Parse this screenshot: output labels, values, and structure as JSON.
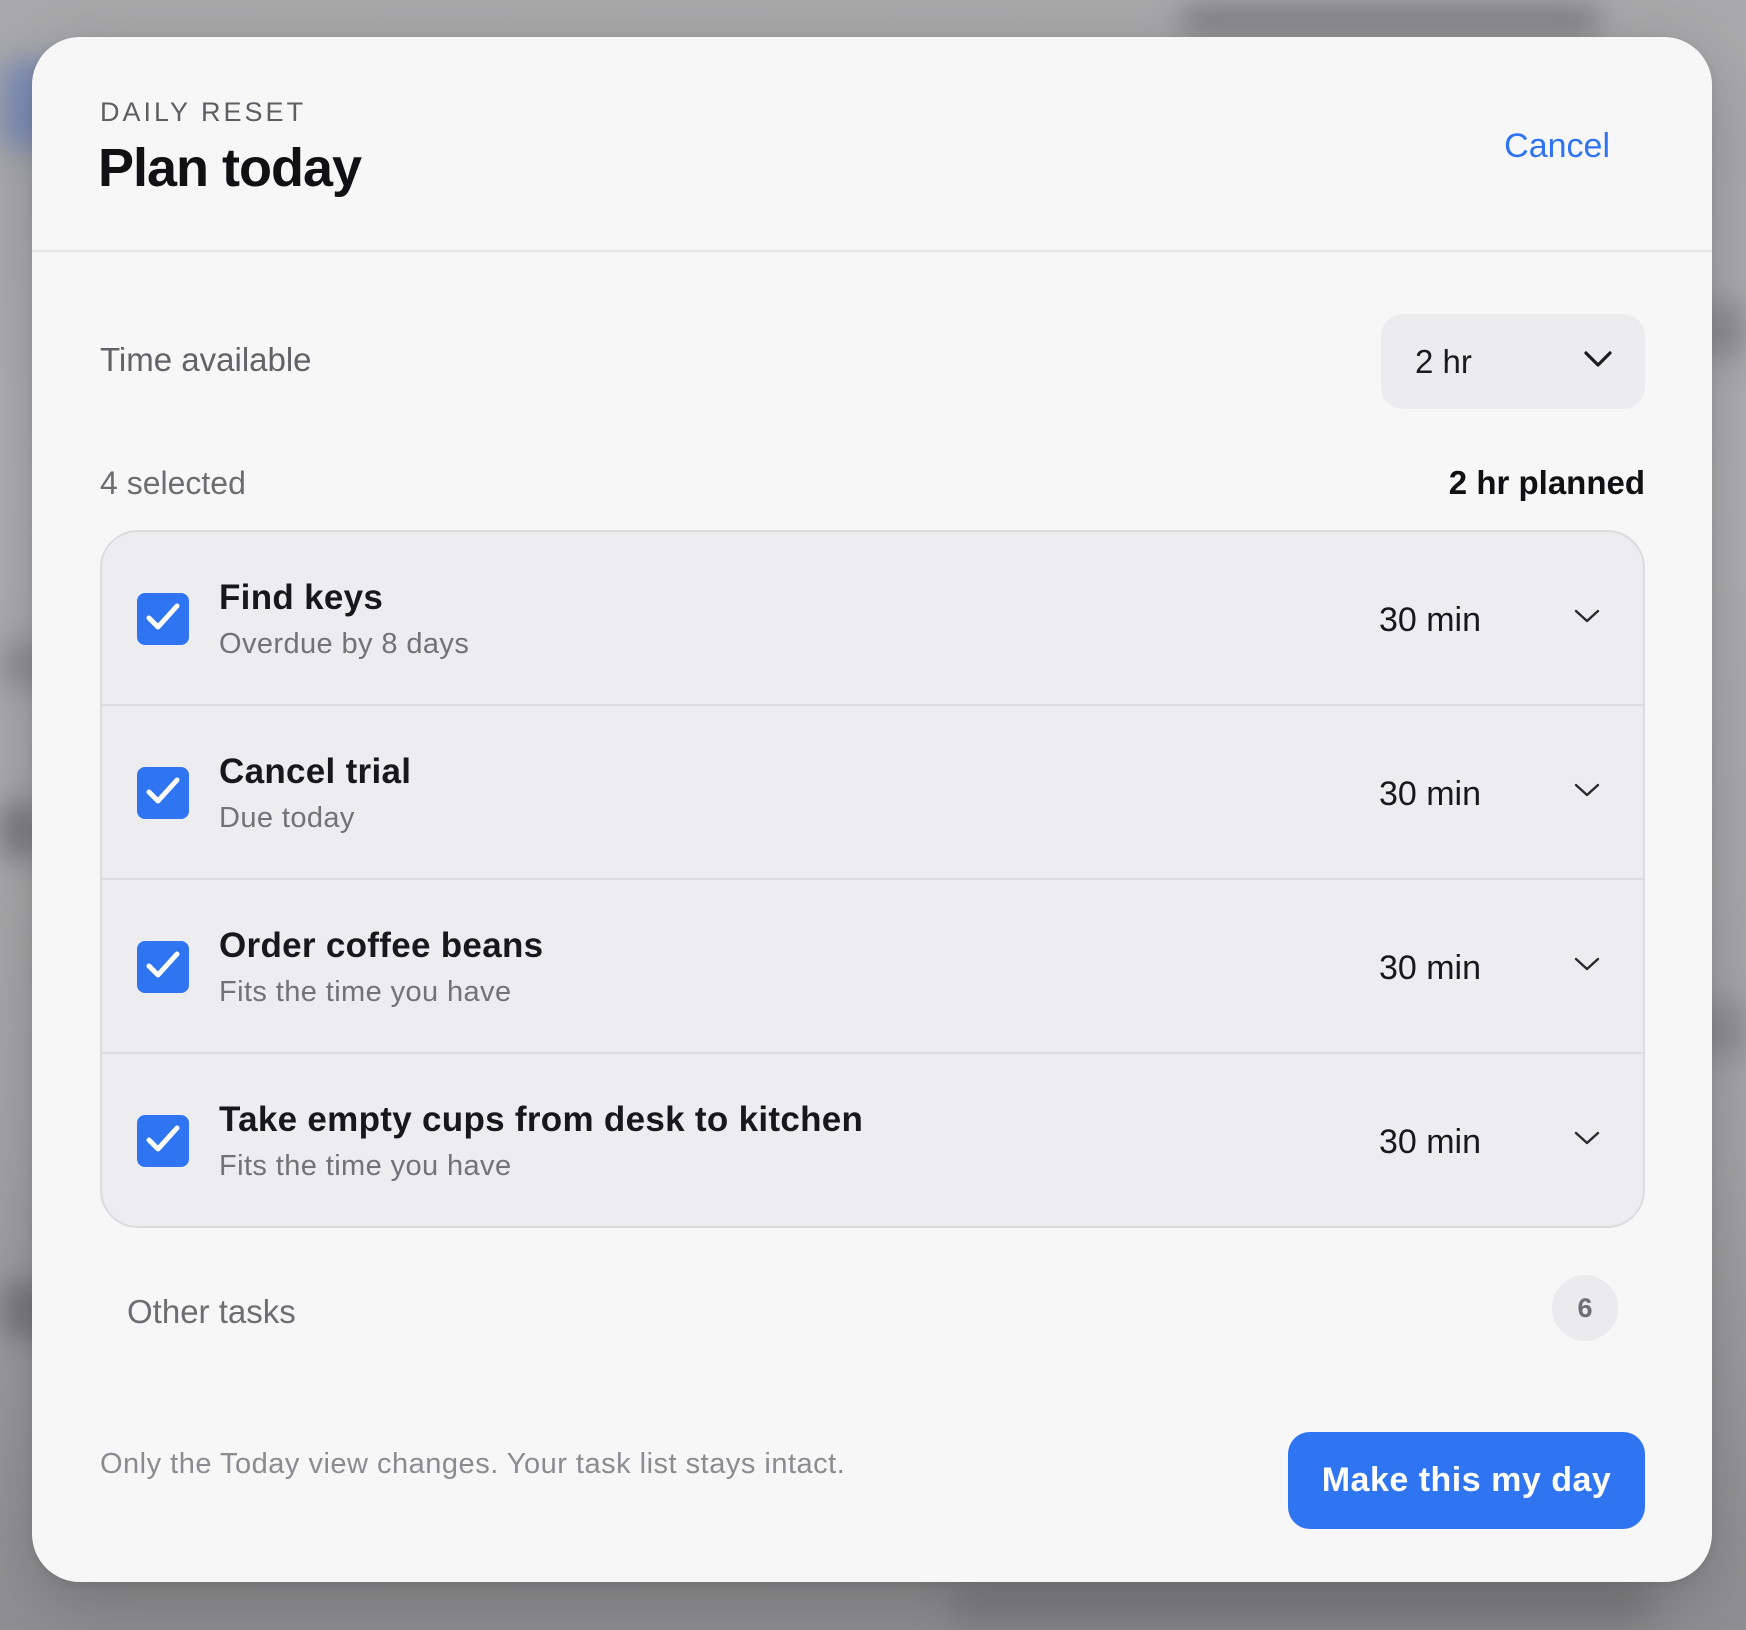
{
  "header": {
    "eyebrow": "DAILY RESET",
    "title": "Plan today",
    "cancel_label": "Cancel"
  },
  "time": {
    "label": "Time available",
    "value": "2 hr"
  },
  "summary": {
    "selected": "4 selected",
    "planned": "2 hr planned"
  },
  "tasks": [
    {
      "title": "Find keys",
      "subtitle": "Overdue by 8 days",
      "duration": "30 min",
      "checked": true
    },
    {
      "title": "Cancel trial",
      "subtitle": "Due today",
      "duration": "30 min",
      "checked": true
    },
    {
      "title": "Order coffee beans",
      "subtitle": "Fits the time you have",
      "duration": "30 min",
      "checked": true
    },
    {
      "title": "Take empty cups from desk to kitchen",
      "subtitle": "Fits the time you have",
      "duration": "30 min",
      "checked": true
    }
  ],
  "other_tasks": {
    "label": "Other tasks",
    "count": "6"
  },
  "footer": {
    "note": "Only the Today view changes. Your task list stays intact.",
    "primary_label": "Make this my day"
  },
  "icons": {
    "checkbox": "checkmark-icon",
    "dropdown": "chevron-down-icon"
  },
  "colors": {
    "accent": "#2f74f0",
    "dialog_bg": "#f7f7f8",
    "list_bg": "#ededef"
  }
}
